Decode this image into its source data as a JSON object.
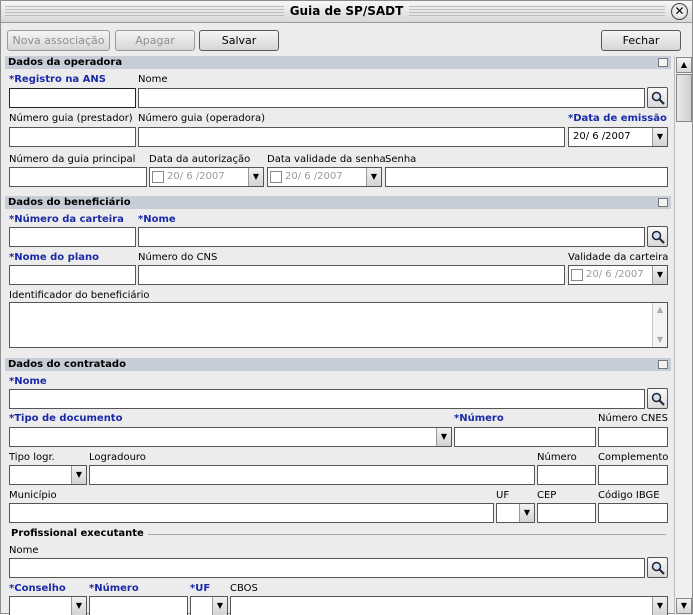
{
  "window": {
    "title": "Guia de SP/SADT"
  },
  "toolbar": {
    "nova_associacao": "Nova associação",
    "apagar": "Apagar",
    "salvar": "Salvar",
    "fechar": "Fechar"
  },
  "operadora": {
    "section": "Dados da operadora",
    "registro_ans": "*Registro na ANS",
    "nome": "Nome",
    "numero_guia_prestador": "Número guia (prestador)",
    "numero_guia_operadora": "Número guia (operadora)",
    "data_emissao": "*Data de emissão",
    "data_emissao_value": "20/ 6 /2007",
    "numero_guia_principal": "Número da guia principal",
    "data_autorizacao": "Data da autorização",
    "data_autorizacao_value": "20/ 6 /2007",
    "data_validade_senha": "Data validade da senha",
    "data_validade_senha_value": "20/ 6 /2007",
    "senha": "Senha"
  },
  "beneficiario": {
    "section": "Dados do beneficiário",
    "numero_carteira": "*Número da carteira",
    "nome": "*Nome",
    "nome_plano": "*Nome do plano",
    "numero_cns": "Número do CNS",
    "validade_carteira": "Validade da carteira",
    "validade_carteira_value": "20/ 6 /2007",
    "identificador": "Identificador do beneficiário"
  },
  "contratado": {
    "section": "Dados do contratado",
    "nome": "*Nome",
    "tipo_documento": "*Tipo de documento",
    "numero": "*Número",
    "numero_cnes": "Número CNES",
    "tipo_logr": "Tipo logr.",
    "logradouro": "Logradouro",
    "numero_end": "Número",
    "complemento": "Complemento",
    "municipio": "Município",
    "uf": "UF",
    "cep": "CEP",
    "codigo_ibge": "Código IBGE",
    "profissional_executante": "Profissional executante",
    "prof_nome": "Nome",
    "conselho": "*Conselho",
    "prof_numero": "*Número",
    "prof_uf": "*UF",
    "cbos": "CBOS"
  },
  "icons": {
    "lookup": "magnifier-icon",
    "close": "close-icon",
    "dropdown": "chevron-down-icon"
  }
}
